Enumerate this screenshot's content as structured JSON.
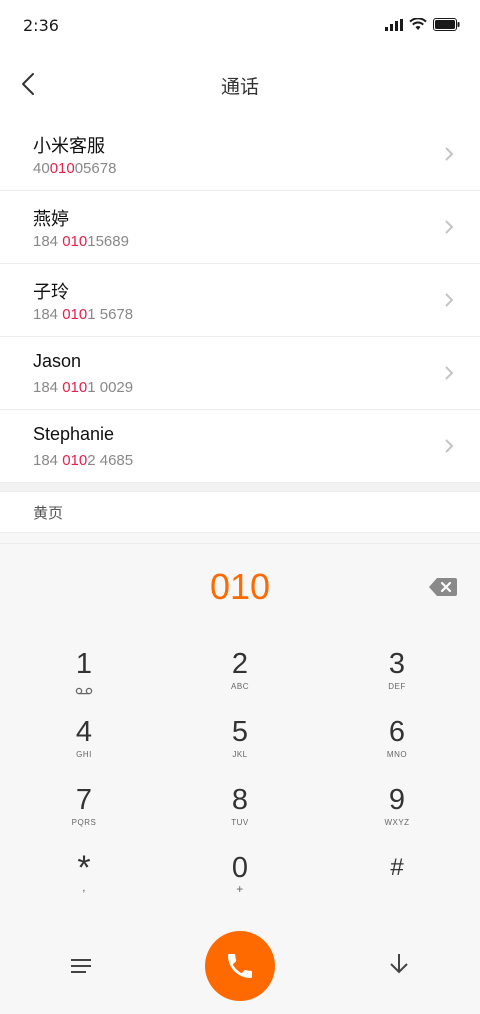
{
  "status": {
    "time": "2:36"
  },
  "header": {
    "title": "通话"
  },
  "contacts": [
    {
      "name": "小米客服",
      "num_pre": "40",
      "num_hl": "010",
      "num_post": "05678"
    },
    {
      "name": "燕婷",
      "num_pre": "184 ",
      "num_hl": "010",
      "num_post": "15689"
    },
    {
      "name": "子玲",
      "num_pre": "184 ",
      "num_hl": "010",
      "num_post": "1 5678"
    },
    {
      "name": "Jason",
      "num_pre": "184 ",
      "num_hl": "010",
      "num_post": "1 0029"
    },
    {
      "name": "Stephanie",
      "num_pre": "184 ",
      "num_hl": "010",
      "num_post": "2 4685"
    }
  ],
  "yellow_pages": {
    "label": "黄页"
  },
  "dialer": {
    "input": "010",
    "keys": [
      {
        "digit": "1",
        "letters": "voicemail"
      },
      {
        "digit": "2",
        "letters": "ABC"
      },
      {
        "digit": "3",
        "letters": "DEF"
      },
      {
        "digit": "4",
        "letters": "GHI"
      },
      {
        "digit": "5",
        "letters": "JKL"
      },
      {
        "digit": "6",
        "letters": "MNO"
      },
      {
        "digit": "7",
        "letters": "PQRS"
      },
      {
        "digit": "8",
        "letters": "TUV"
      },
      {
        "digit": "9",
        "letters": "WXYZ"
      },
      {
        "digit": "*",
        "letters": ","
      },
      {
        "digit": "0",
        "letters": "+"
      },
      {
        "digit": "#",
        "letters": ""
      }
    ]
  },
  "colors": {
    "accent": "#ff6a00",
    "highlight": "#e5204b"
  }
}
